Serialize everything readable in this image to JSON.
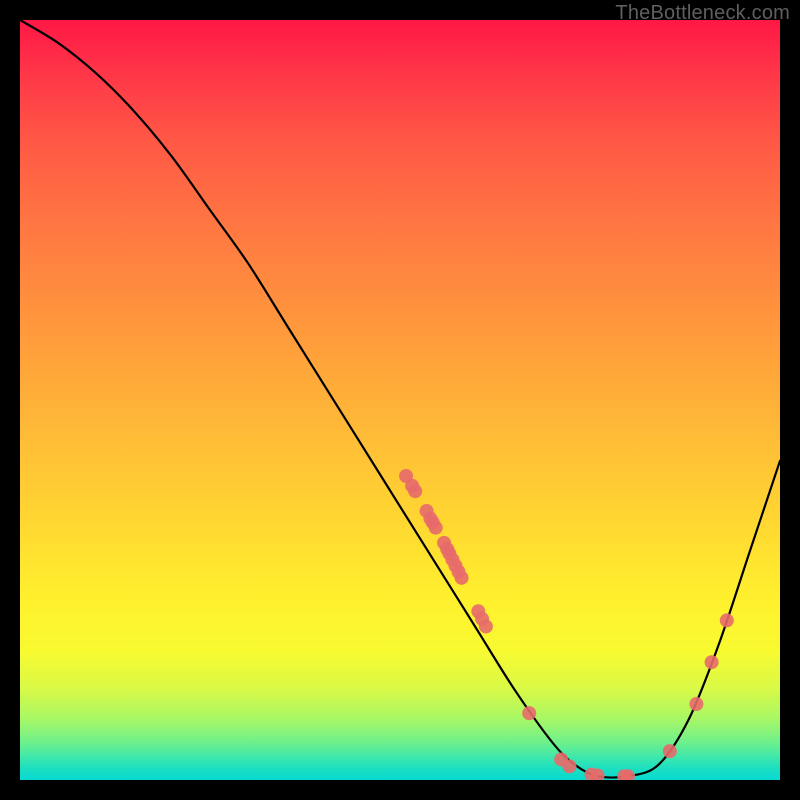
{
  "watermark": "TheBottleneck.com",
  "colors": {
    "page_bg": "#000000",
    "curve": "#000000",
    "marker": "#e76a6a",
    "gradient_top": "#ff1846",
    "gradient_bottom": "#07d9d0"
  },
  "chart_data": {
    "type": "line",
    "title": "",
    "xlabel": "",
    "ylabel": "",
    "xlim": [
      0,
      100
    ],
    "ylim": [
      0,
      100
    ],
    "grid": false,
    "legend": false,
    "series": [
      {
        "name": "curve",
        "x": [
          0,
          5,
          10,
          15,
          20,
          25,
          30,
          35,
          40,
          45,
          50,
          55,
          60,
          65,
          70,
          73,
          76,
          80,
          84,
          88,
          92,
          96,
          100
        ],
        "y": [
          100,
          97,
          93,
          88,
          82,
          75,
          68,
          60,
          52,
          44,
          36,
          28,
          20,
          12,
          5,
          2,
          0.5,
          0.5,
          2,
          8,
          18,
          30,
          42
        ]
      }
    ],
    "markers": {
      "name": "highlight-points",
      "points": [
        {
          "x": 50.8,
          "y": 40.0
        },
        {
          "x": 51.6,
          "y": 38.7
        },
        {
          "x": 52.0,
          "y": 38.0
        },
        {
          "x": 53.5,
          "y": 35.4
        },
        {
          "x": 54.0,
          "y": 34.4
        },
        {
          "x": 54.3,
          "y": 33.9
        },
        {
          "x": 54.7,
          "y": 33.2
        },
        {
          "x": 55.8,
          "y": 31.2
        },
        {
          "x": 56.2,
          "y": 30.4
        },
        {
          "x": 56.5,
          "y": 29.8
        },
        {
          "x": 56.9,
          "y": 29.0
        },
        {
          "x": 57.3,
          "y": 28.2
        },
        {
          "x": 57.7,
          "y": 27.4
        },
        {
          "x": 58.1,
          "y": 26.6
        },
        {
          "x": 60.3,
          "y": 22.2
        },
        {
          "x": 60.8,
          "y": 21.2
        },
        {
          "x": 61.3,
          "y": 20.2
        },
        {
          "x": 67.0,
          "y": 8.8
        },
        {
          "x": 71.2,
          "y": 2.7
        },
        {
          "x": 72.3,
          "y": 1.8
        },
        {
          "x": 75.2,
          "y": 0.7
        },
        {
          "x": 76.0,
          "y": 0.6
        },
        {
          "x": 79.5,
          "y": 0.5
        },
        {
          "x": 80.0,
          "y": 0.5
        },
        {
          "x": 85.5,
          "y": 3.8
        },
        {
          "x": 89.0,
          "y": 10.0
        },
        {
          "x": 91.0,
          "y": 15.5
        },
        {
          "x": 93.0,
          "y": 21.0
        }
      ]
    }
  }
}
